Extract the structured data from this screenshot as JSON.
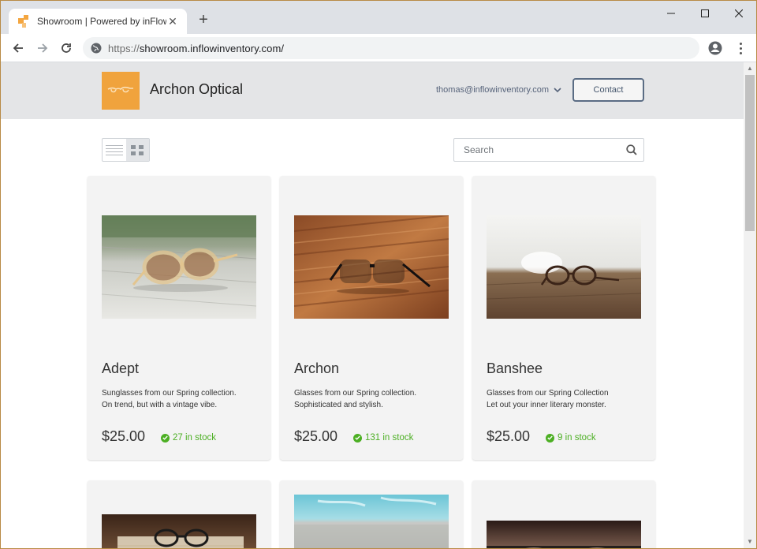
{
  "browser": {
    "tab_title": "Showroom | Powered by inFlow",
    "url_scheme": "https://",
    "url_host": "showroom.inflowinventory.com/"
  },
  "header": {
    "brand": "Archon Optical",
    "account_email": "thomas@inflowinventory.com",
    "contact_label": "Contact"
  },
  "search": {
    "placeholder": "Search"
  },
  "products": [
    {
      "name": "Adept",
      "desc_line1": "Sunglasses from our Spring collection.",
      "desc_line2": "On trend, but with a vintage vibe.",
      "price": "$25.00",
      "stock": "27 in stock"
    },
    {
      "name": "Archon",
      "desc_line1": "Glasses from our Spring collection.",
      "desc_line2": "Sophisticated and stylish.",
      "price": "$25.00",
      "stock": "131 in stock"
    },
    {
      "name": "Banshee",
      "desc_line1": "Glasses from our Spring Collection",
      "desc_line2": "Let out your inner literary monster.",
      "price": "$25.00",
      "stock": "9 in stock"
    }
  ],
  "colors": {
    "accent": "#f0a33d",
    "stock_green": "#4caf23",
    "header_bg": "#e4e5e7"
  },
  "icons": {
    "favicon": "inflow-logo-icon",
    "logo": "glasses-logo-icon",
    "search": "search-icon",
    "stock": "check-circle-icon"
  }
}
